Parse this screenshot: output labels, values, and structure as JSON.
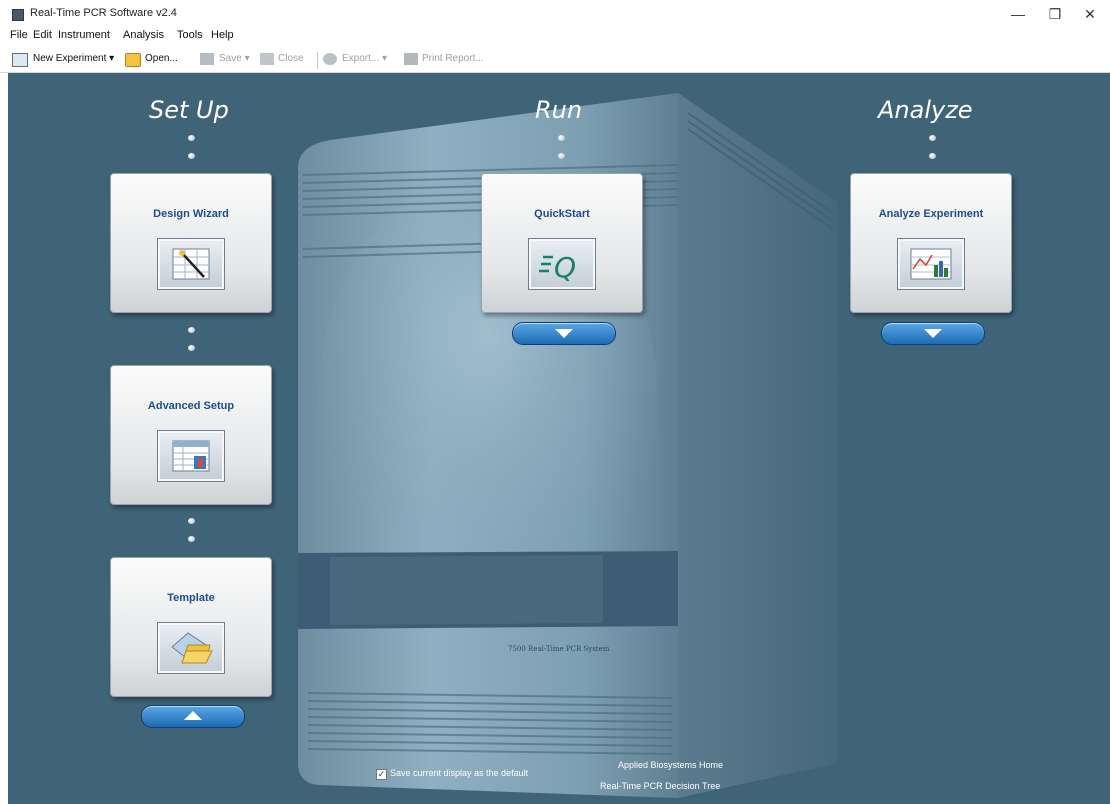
{
  "window": {
    "title": "Real-Time PCR Software v2.4",
    "minimize": "—",
    "maximize": "❐",
    "close": "✕"
  },
  "menu": [
    "File",
    "Edit",
    "Instrument",
    "Analysis",
    "Tools",
    "Help"
  ],
  "toolbar": {
    "new_experiment": "New Experiment",
    "open": "Open...",
    "save": "Save",
    "close": "Close",
    "export": "Export...",
    "print_report": "Print Report..."
  },
  "sections": {
    "setup": "Set Up",
    "run": "Run",
    "analyze": "Analyze"
  },
  "tiles": {
    "design_wizard": "Design Wizard",
    "advanced_setup": "Advanced Setup",
    "template": "Template",
    "quickstart": "QuickStart",
    "analyze_experiment": "Analyze Experiment"
  },
  "instrument_front_label": "7500 Real-Time PCR System",
  "footer": {
    "save_default": "Save current display as the default",
    "save_default_checked": true,
    "ab_home": "Applied Biosystems Home",
    "decision_tree": "Real-Time PCR Decision Tree"
  },
  "colors": {
    "stage_bg": "#3f6478",
    "accent_blue": "#1d6bb3",
    "tile_label": "#1f4e86"
  }
}
